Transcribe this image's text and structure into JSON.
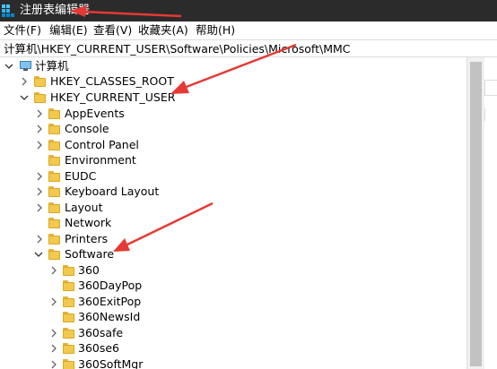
{
  "window": {
    "title": "注册表编辑器"
  },
  "menu": {
    "items": [
      "文件(F)",
      "编辑(E)",
      "查看(V)",
      "收藏夹(A)",
      "帮助(H)"
    ]
  },
  "address": {
    "path": "计算机\\HKEY_CURRENT_USER\\Software\\Policies\\Microsoft\\MMC"
  },
  "tree": {
    "root": "计算机",
    "hives": [
      "HKEY_CLASSES_ROOT",
      "HKEY_CURRENT_USER"
    ],
    "hkcu_children": [
      "AppEvents",
      "Console",
      "Control Panel",
      "Environment",
      "EUDC",
      "Keyboard Layout",
      "Layout",
      "Network",
      "Printers",
      "Software"
    ],
    "software_children": [
      "360",
      "360DayPop",
      "360ExitPop",
      "360NewsId",
      "360safe",
      "360se6",
      "360SoftMgr"
    ]
  },
  "colors": {
    "titlebar": "#2b2b2b",
    "folder": "#f2c94c",
    "annotation_arrow": "#e53935"
  }
}
